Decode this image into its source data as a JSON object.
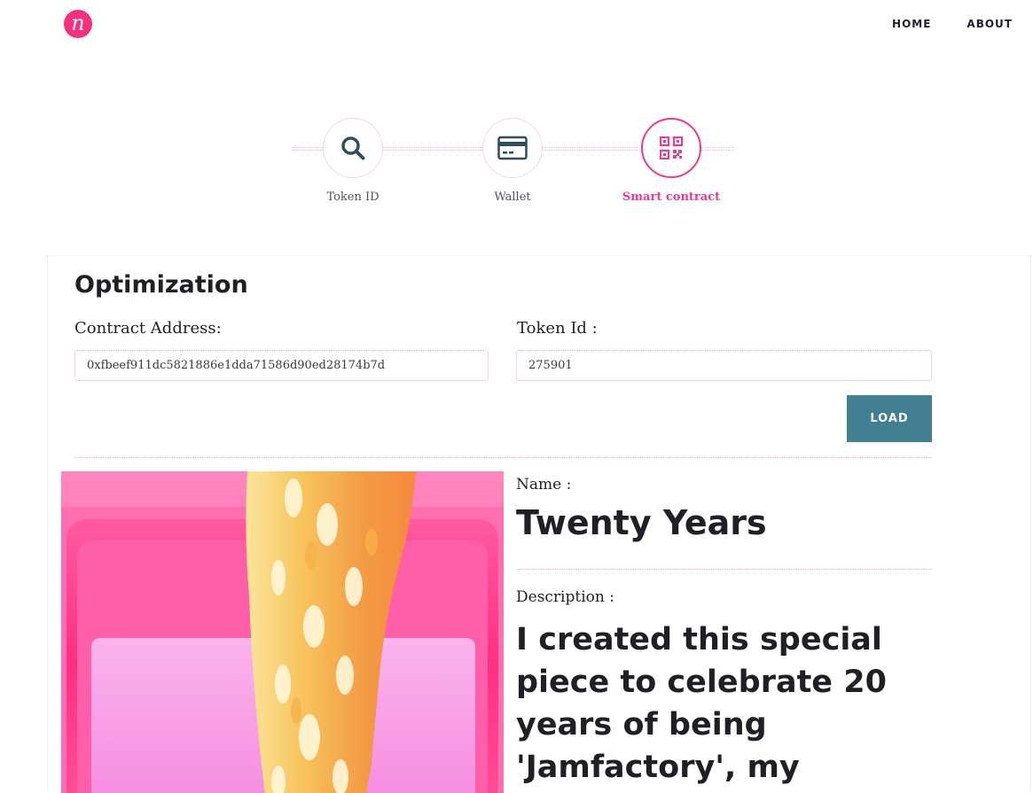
{
  "header": {
    "logo_letter": "n",
    "nav": [
      "HOME",
      "ABOUT"
    ]
  },
  "stepper": {
    "steps": [
      {
        "label": "Token ID",
        "icon": "search-icon"
      },
      {
        "label": "Wallet",
        "icon": "credit-card-icon"
      },
      {
        "label": "Smart contract",
        "icon": "qr-code-icon",
        "active": true
      }
    ]
  },
  "form": {
    "title": "Optimization",
    "contract_label": "Contract Address:",
    "contract_value": "0xfbeef911dc5821886e1dda71586d90ed28174b7d",
    "token_label": "Token Id :",
    "token_value": "275901",
    "load_label": "LOAD"
  },
  "details": {
    "name_label": "Name :",
    "name_value": "Twenty Years",
    "description_label": "Description :",
    "description_value": "I created this special piece to celebrate 20 years of being 'Jamfactory', my"
  },
  "colors": {
    "accent": "#ee3a88",
    "button": "#437f93",
    "heading": "#1e2025"
  }
}
